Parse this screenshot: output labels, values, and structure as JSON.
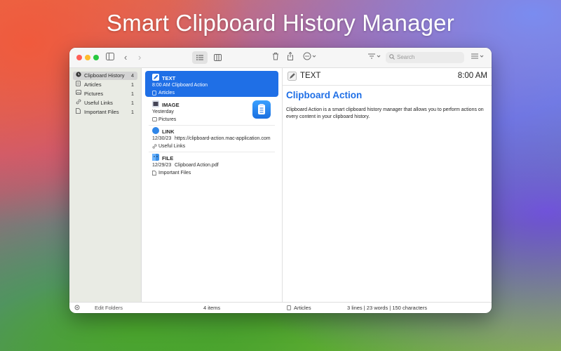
{
  "hero_title": "Smart Clipboard History Manager",
  "colors": {
    "accent": "#1f6fe6",
    "title_accent": "#1f6fe6",
    "close": "#ff5f57",
    "minimize": "#febc2e",
    "zoom": "#28c840"
  },
  "toolbar": {
    "search_placeholder": "Search",
    "icons": [
      "sidebar-toggle-icon",
      "chevron-left-icon",
      "chevron-right-icon",
      "list-view-icon",
      "column-view-icon",
      "trash-icon",
      "share-icon",
      "more-icon",
      "sort-icon",
      "filter-icon"
    ]
  },
  "sidebar": {
    "items": [
      {
        "label": "Clipboard History",
        "count": "4",
        "icon": "clock-icon",
        "selected": true
      },
      {
        "label": "Articles",
        "count": "1",
        "icon": "document-icon"
      },
      {
        "label": "Pictures",
        "count": "1",
        "icon": "photo-icon"
      },
      {
        "label": "Useful Links",
        "count": "1",
        "icon": "link-icon"
      },
      {
        "label": "Important Files",
        "count": "1",
        "icon": "file-icon"
      }
    ],
    "edit_folders": "Edit Folders"
  },
  "list": {
    "items": [
      {
        "type": "TEXT",
        "time": "8:00 AM",
        "content": "Clipboard Action",
        "folder": "Articles",
        "selected": true
      },
      {
        "type": "IMAGE",
        "time": "Yesterday",
        "content": "",
        "folder": "Pictures"
      },
      {
        "type": "LINK",
        "time": "12/30/23",
        "content": "https://clipboard-action.mac-application.com",
        "folder": "Useful Links"
      },
      {
        "type": "FILE",
        "time": "12/29/23",
        "content": "Clipboard Action.pdf",
        "folder": "Important Files"
      }
    ],
    "footer": "4 items"
  },
  "detail": {
    "type": "TEXT",
    "time": "8:00 AM",
    "title": "Clipboard Action",
    "body": "Clipboard Action is a smart clipboard history manager that allows you to perform actions on every content in your clipboard history.",
    "folder": "Articles",
    "stats": "3 lines | 23 words | 150 characters"
  }
}
